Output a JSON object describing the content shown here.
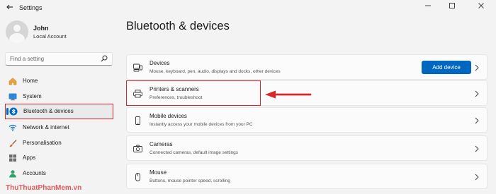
{
  "window": {
    "title": "Settings",
    "minimize_icon": "minimize-icon",
    "maximize_icon": "maximize-icon",
    "close_icon": "close-icon"
  },
  "profile": {
    "name": "John",
    "account_type": "Local Account"
  },
  "search": {
    "placeholder": "Find a setting"
  },
  "sidebar": {
    "items": [
      {
        "label": "Home",
        "icon": "home-icon",
        "selected": false
      },
      {
        "label": "System",
        "icon": "monitor-icon",
        "selected": false
      },
      {
        "label": "Bluetooth & devices",
        "icon": "bluetooth-icon",
        "selected": true
      },
      {
        "label": "Network & internet",
        "icon": "wifi-icon",
        "selected": false
      },
      {
        "label": "Personalisation",
        "icon": "paintbrush-icon",
        "selected": false
      },
      {
        "label": "Apps",
        "icon": "apps-icon",
        "selected": false
      },
      {
        "label": "Accounts",
        "icon": "person-icon",
        "selected": false
      }
    ]
  },
  "main": {
    "title": "Bluetooth & devices",
    "cards": [
      {
        "title": "Devices",
        "description": "Mouse, keyboard, pen, audio, displays and docks, other devices",
        "icon": "devices-icon",
        "action": "Add device"
      },
      {
        "title": "Printers & scanners",
        "description": "Preferences, troubleshoot",
        "icon": "printer-icon"
      },
      {
        "title": "Mobile devices",
        "description": "Instantly access your mobile devices from your PC",
        "icon": "phone-icon"
      },
      {
        "title": "Cameras",
        "description": "Connected cameras, default image settings",
        "icon": "camera-icon"
      },
      {
        "title": "Mouse",
        "description": "Buttons, mouse pointer speed, scrolling",
        "icon": "mouse-icon"
      }
    ]
  },
  "colors": {
    "accent": "#0067c0",
    "highlight_red": "#d9262b"
  },
  "watermark": "ThuThuatPhanMem.vn"
}
